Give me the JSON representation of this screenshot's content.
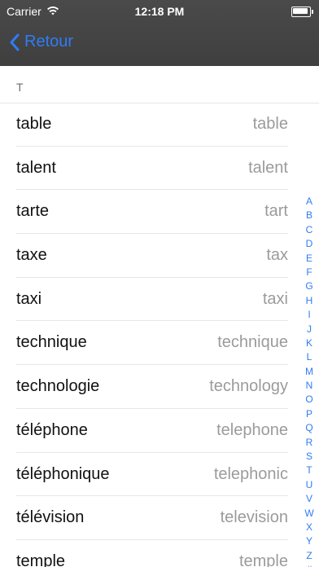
{
  "status_bar": {
    "carrier": "Carrier",
    "time": "12:18 PM"
  },
  "nav": {
    "back_label": "Retour",
    "back_icon": "chevron-left-icon",
    "accent_color": "#2f7cf6"
  },
  "section": {
    "header": "T"
  },
  "rows": [
    {
      "fr": "table",
      "en": "table"
    },
    {
      "fr": "talent",
      "en": "talent"
    },
    {
      "fr": "tarte",
      "en": "tart"
    },
    {
      "fr": "taxe",
      "en": "tax"
    },
    {
      "fr": "taxi",
      "en": "taxi"
    },
    {
      "fr": "technique",
      "en": "technique"
    },
    {
      "fr": "technologie",
      "en": "technology"
    },
    {
      "fr": "téléphone",
      "en": "telephone"
    },
    {
      "fr": "téléphonique",
      "en": "telephonic"
    },
    {
      "fr": "télévision",
      "en": "television"
    },
    {
      "fr": "temple",
      "en": "temple"
    }
  ],
  "index_letters": [
    "A",
    "B",
    "C",
    "D",
    "E",
    "F",
    "G",
    "H",
    "I",
    "J",
    "K",
    "L",
    "M",
    "N",
    "O",
    "P",
    "Q",
    "R",
    "S",
    "T",
    "U",
    "V",
    "W",
    "X",
    "Y",
    "Z",
    "#"
  ]
}
